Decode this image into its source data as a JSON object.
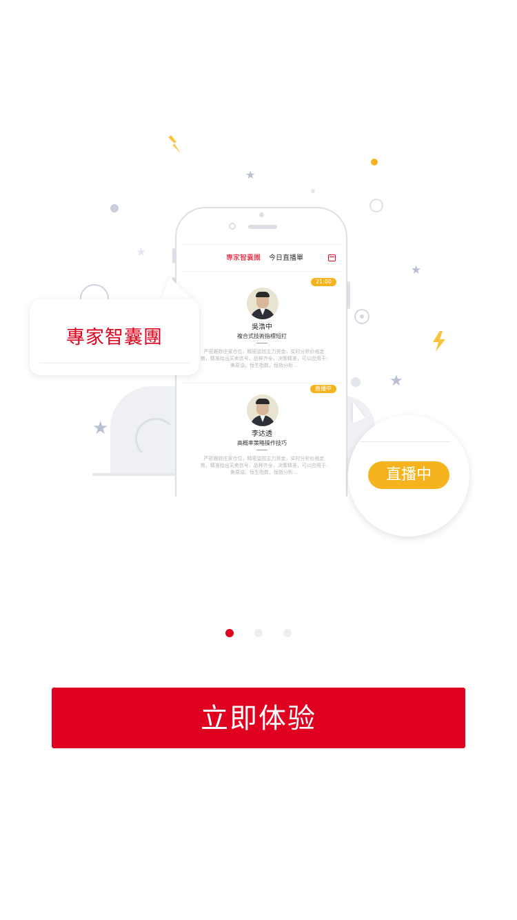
{
  "phone_screen": {
    "tabs": {
      "experts": "專家智囊團",
      "today": "今日直播單"
    },
    "icons": {
      "calendar": "calendar-icon"
    },
    "cards": [
      {
        "badge": "21:00",
        "name": "吳浩中",
        "title": "複合式技術指標短打",
        "description": "严密跟踪庄家仓位，精密监控主力资金，实时分析价格走势，精准给出买卖信号，品种齐全，决策精准，可以应用于:美原油，恒生指数，恒指分析…"
      },
      {
        "badge": "直播中",
        "name": "李达透",
        "title": "高概率策略操作技巧",
        "description": "严密跟踪庄家仓位，精密监控主力资金，实时分析价格走势，精准给出买卖信号，品种齐全，决策精准，可以应用于:美原油，恒生指数，恒指分析…"
      }
    ]
  },
  "bubbles": {
    "left_label": "專家智囊團",
    "right_label": "直播中"
  },
  "pagination": {
    "total": 3,
    "active_index": 0
  },
  "cta": {
    "label": "立即体验"
  },
  "colors": {
    "accent_red": "#e0001f",
    "accent_yellow": "#f5b41e",
    "dot_inactive": "#eeeeee"
  }
}
